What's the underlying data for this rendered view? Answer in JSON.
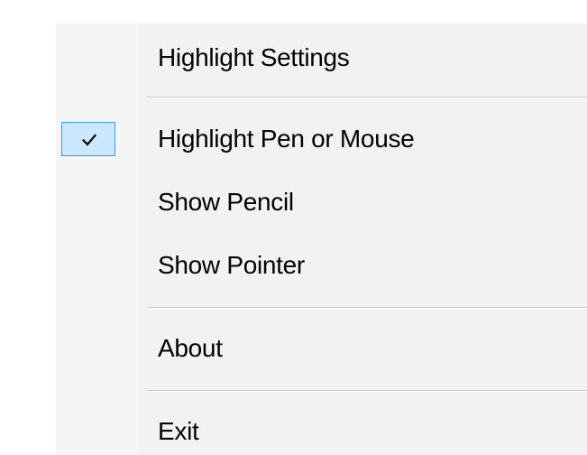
{
  "menu": {
    "items": [
      {
        "id": "highlight-settings",
        "label": "Highlight Settings",
        "checked": false
      },
      {
        "id": "highlight-pen-or-mouse",
        "label": "Highlight Pen or Mouse",
        "checked": true
      },
      {
        "id": "show-pencil",
        "label": "Show Pencil",
        "checked": false
      },
      {
        "id": "show-pointer",
        "label": "Show Pointer",
        "checked": false
      },
      {
        "id": "about",
        "label": "About",
        "checked": false
      },
      {
        "id": "exit",
        "label": "Exit",
        "checked": false
      }
    ],
    "check_icon": "checkmark-icon",
    "colors": {
      "check_highlight_fill": "#cce8ff",
      "check_highlight_border": "#3399ff",
      "menu_background": "#f2f2f2",
      "separator": "#c8c8c8",
      "text": "#000000"
    }
  }
}
